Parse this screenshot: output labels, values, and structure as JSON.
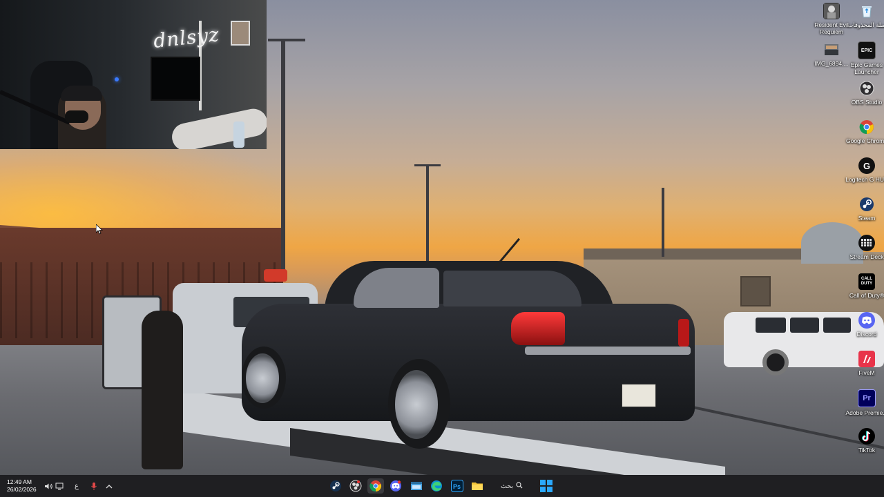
{
  "desktop": {
    "icons": [
      {
        "label": "سلة المحذوفات",
        "icon": "recycle-bin-icon"
      },
      {
        "label": "Resident Evil Requiem",
        "icon": "game-icon"
      },
      {
        "label": "Epic Games Launcher",
        "icon": "epic-games-icon",
        "glyph": "EPIC"
      },
      {
        "label": "IMG_6894....",
        "icon": "image-file-icon"
      },
      {
        "label": "OBS Studio",
        "icon": "obs-icon"
      },
      {
        "label": "Google Chrome",
        "icon": "chrome-icon"
      },
      {
        "label": "Logitech G HUB",
        "icon": "logitech-icon",
        "glyph": "G"
      },
      {
        "label": "Steam",
        "icon": "steam-icon"
      },
      {
        "label": "Stream Deck",
        "icon": "stream-deck-icon"
      },
      {
        "label": "Call of Duty®",
        "icon": "call-of-duty-icon",
        "glyph": "CALL DUTY"
      },
      {
        "label": "Discord",
        "icon": "discord-icon"
      },
      {
        "label": "FiveM",
        "icon": "fivem-icon"
      },
      {
        "label": "Adobe Premie...",
        "icon": "premiere-icon",
        "glyph": "Pr"
      },
      {
        "label": "TikTok",
        "icon": "tiktok-icon"
      }
    ]
  },
  "webcam": {
    "neon_sign": "dnlsyz"
  },
  "taskbar": {
    "clock_time": "12:49 AM",
    "clock_date": "26/02/2026",
    "language": "ع",
    "search_label": "بحث",
    "apps": [
      {
        "name": "steam",
        "color": "#1b2838"
      },
      {
        "name": "obs",
        "color": "#302e31"
      },
      {
        "name": "chrome",
        "color": "#4285f4"
      },
      {
        "name": "discord",
        "color": "#5865f2"
      },
      {
        "name": "task-view",
        "color": "#4aa3df"
      },
      {
        "name": "edge",
        "color": "#0c8fd0"
      },
      {
        "name": "photoshop",
        "color": "#001e36"
      },
      {
        "name": "file-explorer",
        "color": "#f3c437"
      }
    ]
  },
  "colors": {
    "taskbar_bg": "#1f1f22",
    "start_accent": "#2aa8ff"
  }
}
